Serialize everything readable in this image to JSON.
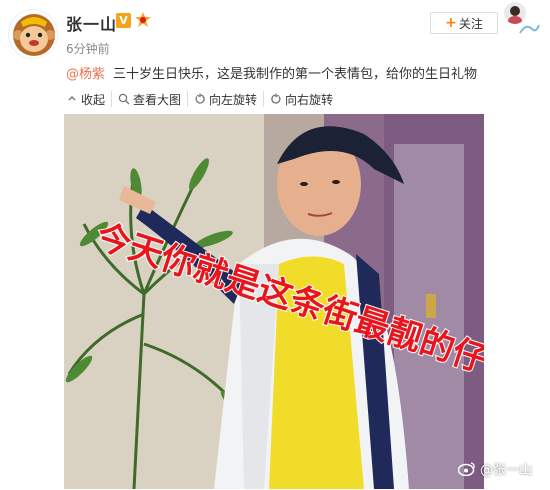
{
  "post": {
    "author": "张一山",
    "vip_badge": "V",
    "timestamp": "6分钟前",
    "follow_label": "关注",
    "mention": "@杨紫",
    "body": "三十岁生日快乐，这是我制作的第一个表情包，给你的生日礼物"
  },
  "toolbar": {
    "collapse": "收起",
    "view_large": "查看大图",
    "rotate_left": "向左旋转",
    "rotate_right": "向右旋转"
  },
  "image": {
    "caption": "今天你就是这条街最靓的仔",
    "watermark": "@张一山"
  },
  "colors": {
    "accent": "#ff8200",
    "mention": "#eb7350",
    "caption_fill": "#e8151c"
  }
}
